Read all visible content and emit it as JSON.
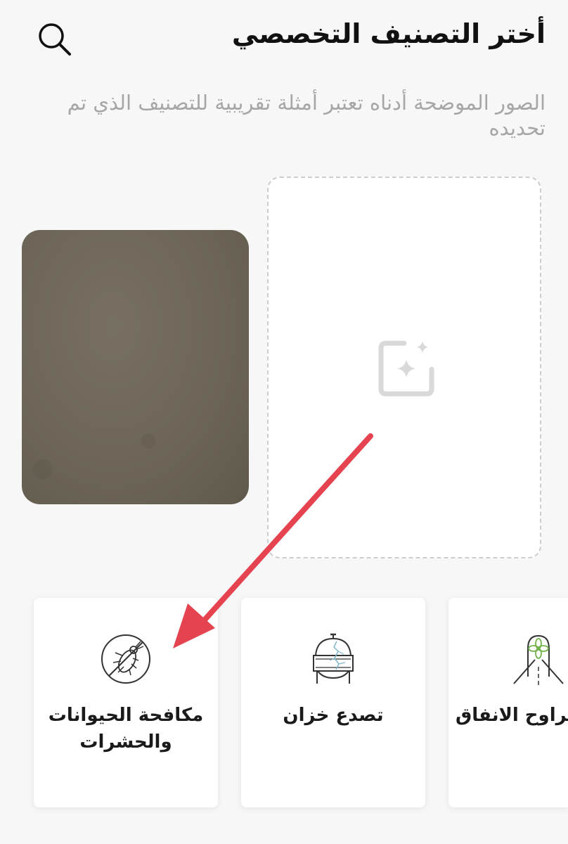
{
  "header": {
    "title": "أختر التصنيف التخصصي",
    "search_icon": "search-icon"
  },
  "subtitle": "الصور الموضحة أدناه تعتبر أمثلة تقريبية للتصنيف الذي تم تحديده",
  "upload": {
    "icon": "add-image-sparkle-icon"
  },
  "annotation": {
    "arrow_color": "#e5434f"
  },
  "categories": [
    {
      "label": "مكافحة الحيوانات والحشرات",
      "icon": "no-insects-icon"
    },
    {
      "label": "تصدع خزان",
      "icon": "cracked-tank-icon"
    },
    {
      "label": "مراوح الانفاق",
      "icon": "tunnel-fan-icon"
    }
  ]
}
